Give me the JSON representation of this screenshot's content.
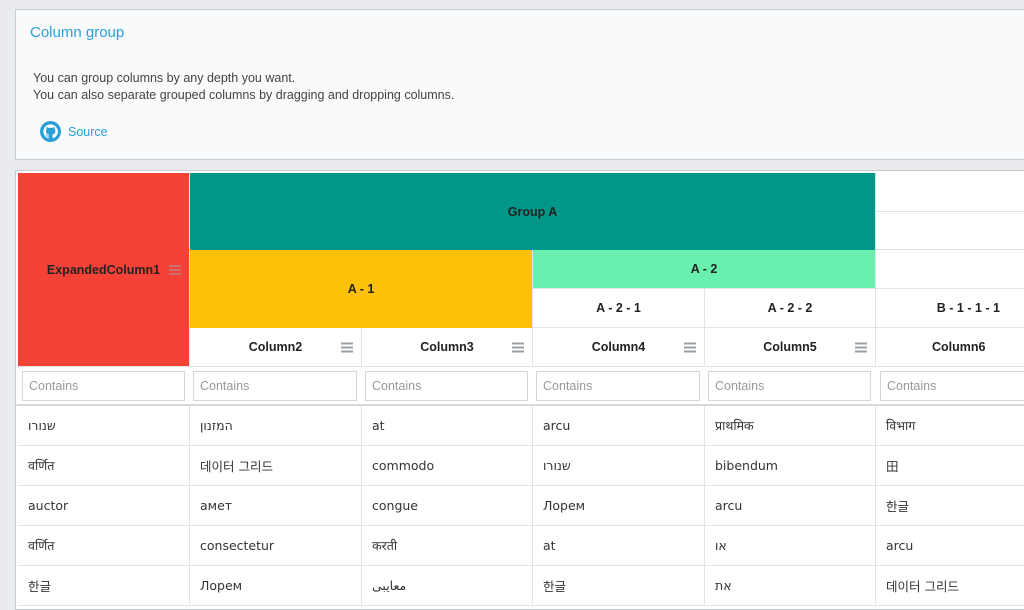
{
  "intro": {
    "title": "Column group",
    "desc_line1": "You can group columns by any depth you want.",
    "desc_line2": "You can also separate grouped columns by dragging and dropping columns.",
    "source_label": "Source",
    "source_icon": "github-icon"
  },
  "colors": {
    "expanded": "#f44336",
    "group_a": "#009688",
    "a1": "#ffc107",
    "a2": "#69f0ae",
    "link": "#2a9fd8"
  },
  "header": {
    "expanded_column1": "ExpandedColumn1",
    "group_a": "Group A",
    "a1": "A - 1",
    "a2": "A - 2",
    "a21": "A - 2 - 1",
    "a22": "A - 2 - 2",
    "b1111": "B - 1 - 1 - 1",
    "column2": "Column2",
    "column3": "Column3",
    "column4": "Column4",
    "column5": "Column5",
    "column6": "Column6"
  },
  "filters": {
    "placeholder": "Contains"
  },
  "rows": [
    [
      "שנורו",
      "המזנון",
      "at",
      "arcu",
      "प्राथमिक",
      "विभाग"
    ],
    [
      "वर्णित",
      "데이터 그리드",
      "commodo",
      "שנורו",
      "bibendum",
      "田"
    ],
    [
      "auctor",
      "амет",
      "congue",
      "Лорем",
      "arcu",
      "한글"
    ],
    [
      "वर्णित",
      "consectetur",
      "करती",
      "at",
      "או",
      "arcu"
    ],
    [
      "한글",
      "Лорем",
      "معايبى",
      "한글",
      "את",
      "데이터 그리드"
    ]
  ]
}
